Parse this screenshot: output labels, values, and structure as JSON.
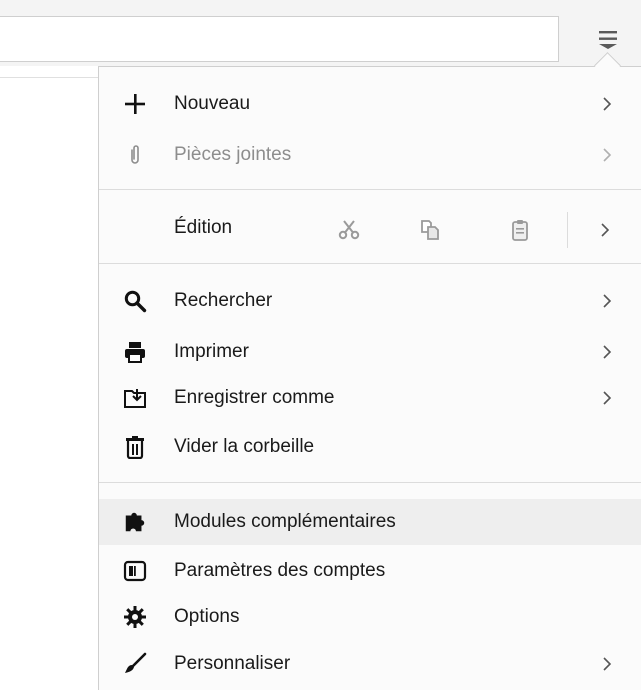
{
  "menu": {
    "new": {
      "label": "Nouveau",
      "icon": "plus-icon"
    },
    "attachments": {
      "label": "Pièces jointes",
      "icon": "paperclip-icon",
      "disabled": true
    },
    "edit": {
      "label": "Édition",
      "cut_icon": "scissors-icon",
      "copy_icon": "copy-icon",
      "paste_icon": "clipboard-icon"
    },
    "find": {
      "label": "Rechercher",
      "icon": "magnifier-icon"
    },
    "print": {
      "label": "Imprimer",
      "icon": "printer-icon"
    },
    "save_as": {
      "label": "Enregistrer comme",
      "icon": "save-icon"
    },
    "empty_trash": {
      "label": "Vider la corbeille",
      "icon": "trash-icon"
    },
    "addons": {
      "label": "Modules complémentaires",
      "icon": "puzzle-icon",
      "hovered": true
    },
    "account_settings": {
      "label": "Paramètres des comptes",
      "icon": "account-settings-icon"
    },
    "options": {
      "label": "Options",
      "icon": "gear-icon"
    },
    "customize": {
      "label": "Personnaliser",
      "icon": "paintbrush-icon"
    }
  },
  "colors": {
    "hover_background": "#eeeeee",
    "disabled_text": "#8d8d8d",
    "icon": "#111111"
  }
}
